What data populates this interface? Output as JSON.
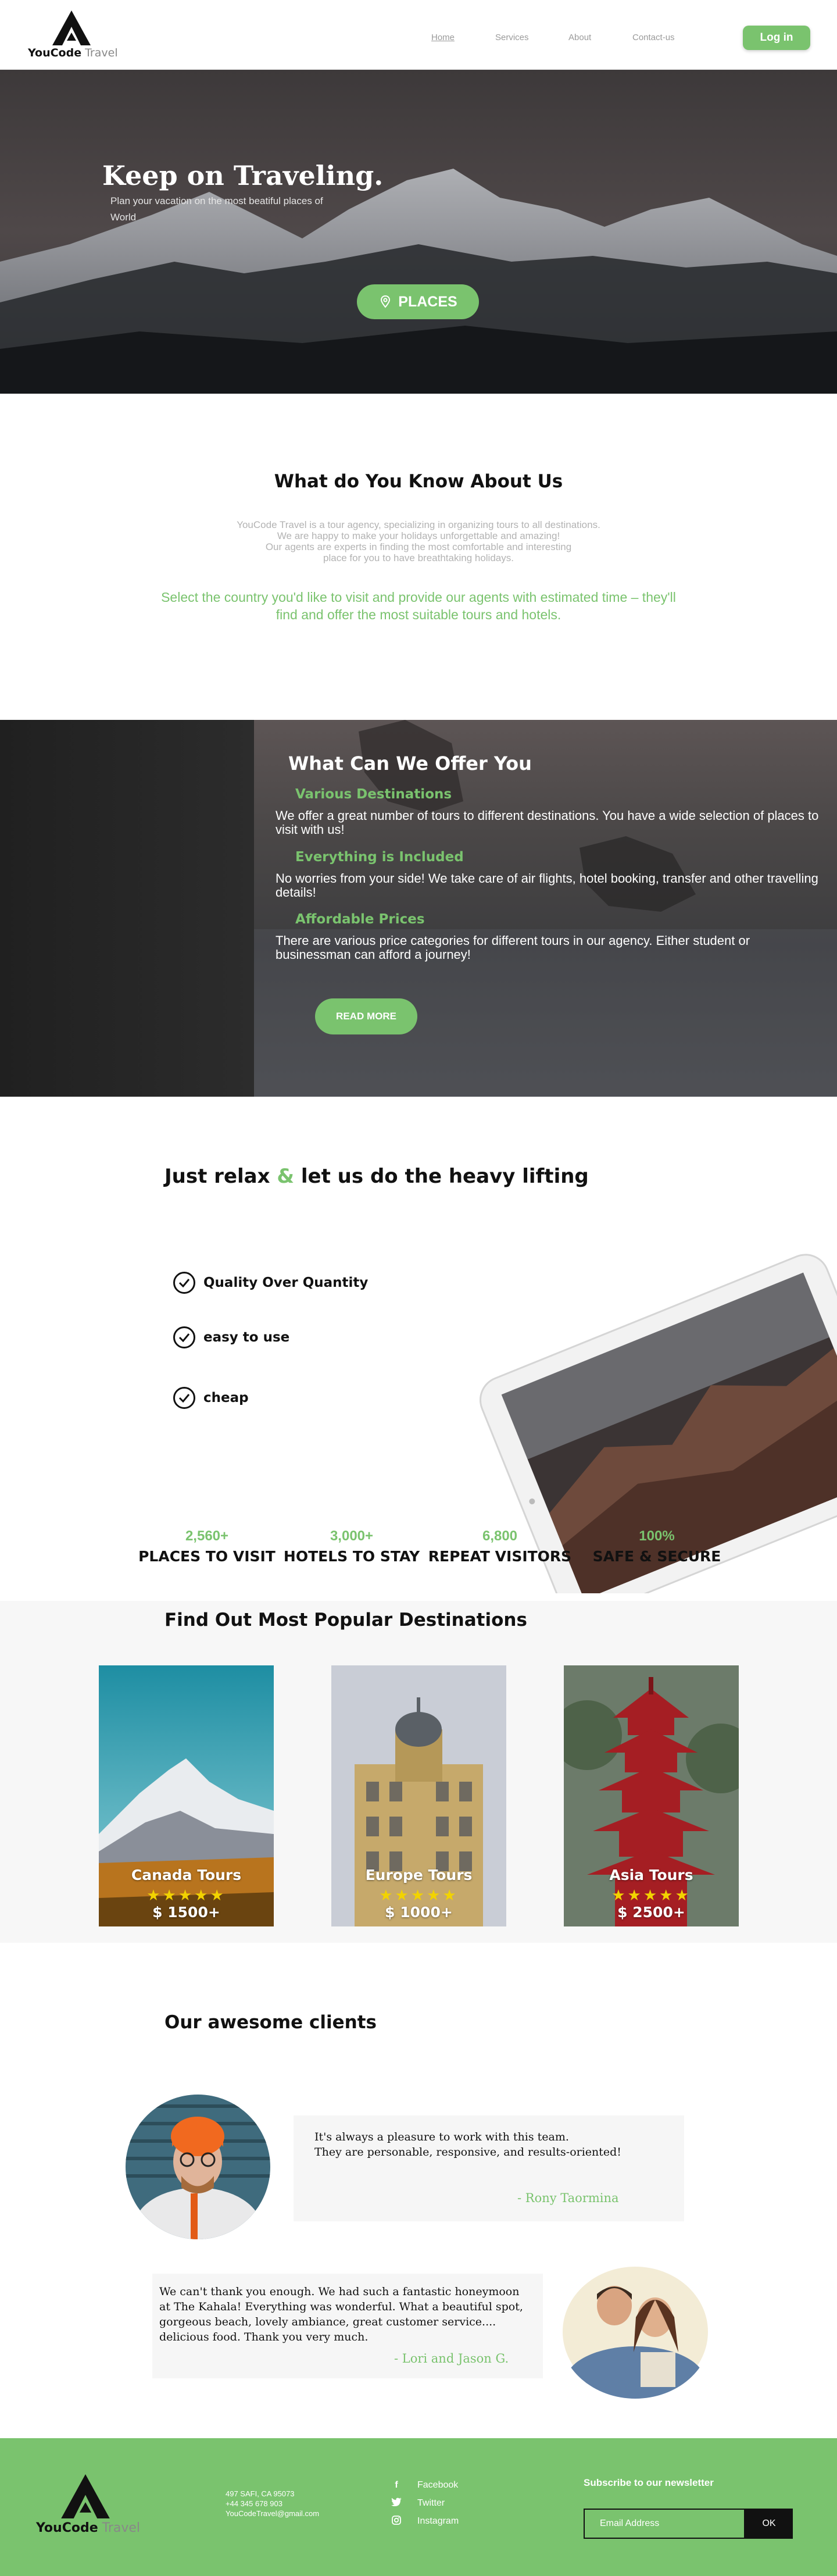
{
  "brand": {
    "name_part1": "YouCode",
    "name_part2": " Travel"
  },
  "nav": {
    "links": [
      "Home",
      "Services",
      "About",
      "Contact-us"
    ],
    "login": "Log in"
  },
  "hero": {
    "title": "Keep on Traveling.",
    "subtitle": "Plan your vacation on the most beatiful places of World",
    "places_button": "PLACES"
  },
  "about": {
    "title": "What do You Know About Us",
    "body": [
      "YouCode Travel is a tour agency, specializing in organizing tours to all destinations.",
      "We are happy to make your holidays unforgettable and amazing!",
      "Our agents are experts in finding the most comfortable and interesting",
      "place for you to have breathtaking holidays."
    ],
    "highlight": "Select the country you'd like to visit and provide our agents with estimated time – they'll find and offer the most suitable tours and hotels."
  },
  "offer": {
    "title": "What Can We Offer You",
    "items": [
      {
        "title": "Various Destinations",
        "text": "We offer a great number of tours to different destinations. You have a wide selection of places to visit with us!"
      },
      {
        "title": "Everything is Included",
        "text": "No worries from your side! We take care of air flights, hotel booking, transfer and other travelling details!"
      },
      {
        "title": "Affordable Prices",
        "text": "There are various price categories for different tours in our agency. Either student or businessman can afford a journey!"
      }
    ],
    "read_more": "READ MORE"
  },
  "relax": {
    "title_part1": "Just relax ",
    "title_amp": "&",
    "title_part2": " let us do the heavy lifting",
    "features": [
      "Quality Over Quantity",
      "easy to use",
      "cheap"
    ]
  },
  "stats": [
    {
      "value": "2,560+",
      "label": "PLACES TO VISIT"
    },
    {
      "value": "3,000+",
      "label": "HOTELS TO STAY"
    },
    {
      "value": "6,800",
      "label": "REPEAT VISITORS"
    },
    {
      "value": "100%",
      "label": "SAFE & SECURE"
    }
  ],
  "popular": {
    "title": "Find Out Most Popular Destinations",
    "cards": [
      {
        "name": "Canada Tours",
        "stars": "★★★★★",
        "price": "$ 1500+"
      },
      {
        "name": "Europe Tours",
        "stars": "★★★★★",
        "price": "$ 1000+"
      },
      {
        "name": "Asia Tours",
        "stars": "★★★★★",
        "price": "$ 2500+"
      }
    ]
  },
  "clients": {
    "title": "Our awesome clients",
    "testimonials": [
      {
        "text_lines": [
          "It's always a pleasure to work with this team.",
          "They are personable, responsive, and results-oriented!"
        ],
        "author": "- Rony Taormina"
      },
      {
        "text_lines": [
          "We can't thank you enough. We had such a fantastic honeymoon",
          "at The Kahala! Everything was wonderful. What a beautiful spot,",
          "gorgeous beach, lovely ambiance, great customer service....",
          "delicious food. Thank you very much."
        ],
        "author": "- Lori and Jason G."
      }
    ]
  },
  "footer": {
    "contact": [
      "497  SAFI, CA 95073",
      "+44 345 678 903",
      "YouCodeTravel@gmail.com"
    ],
    "social": [
      {
        "icon": "facebook-icon",
        "label": "Facebook"
      },
      {
        "icon": "twitter-icon",
        "label": "Twitter"
      },
      {
        "icon": "instagram-icon",
        "label": "Instagram"
      }
    ],
    "newsletter_title": "Subscribe to our newsletter",
    "email_placeholder": "Email Address",
    "ok": "OK"
  },
  "colors": {
    "accent": "#7ac36e",
    "dark": "#111111"
  }
}
